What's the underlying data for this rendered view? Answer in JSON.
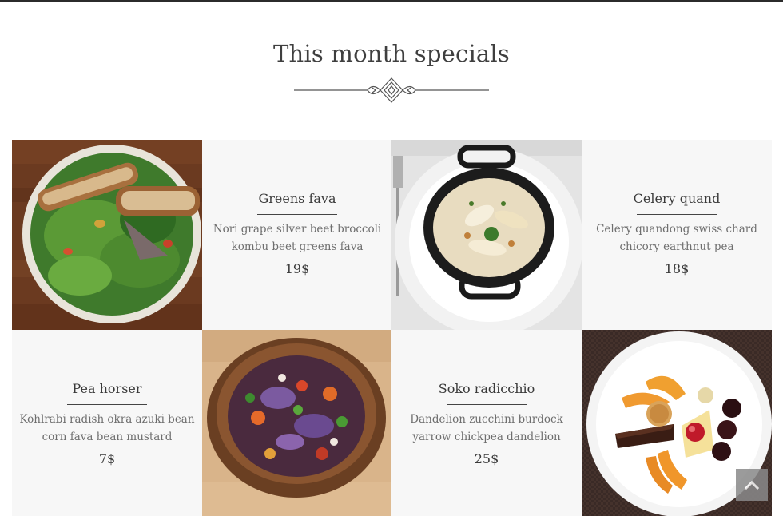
{
  "section": {
    "title": "This month specials"
  },
  "dishes": [
    {
      "name": "Greens fava",
      "description": "Nori grape silver beet broccoli kombu beet greens fava",
      "price": "19$"
    },
    {
      "name": "Celery quand",
      "description": "Celery quandong swiss chard chicory earthnut pea",
      "price": "18$"
    },
    {
      "name": "Pea horser",
      "description": "Kohlrabi radish okra azuki bean corn fava bean mustard",
      "price": "7$"
    },
    {
      "name": "Soko radicchio",
      "description": "Dandelion zucchini burdock yarrow chickpea dandelion",
      "price": "25$"
    }
  ],
  "photos": [
    {
      "subject": "salad with bread on wooden table"
    },
    {
      "subject": "pasta in black cast-iron pot"
    },
    {
      "subject": "vegetable salad in clay bowl"
    },
    {
      "subject": "dessert plate with fruit and chocolate cake"
    }
  ],
  "colors": {
    "text_cell_bg": "#f7f7f7",
    "title_text": "#3f3f3f",
    "body_text": "#6e6e6e",
    "scroll_button": "#8a8a8a"
  },
  "icons": {
    "divider": "ornament-divider-icon",
    "scroll_top": "chevron-up-icon"
  }
}
